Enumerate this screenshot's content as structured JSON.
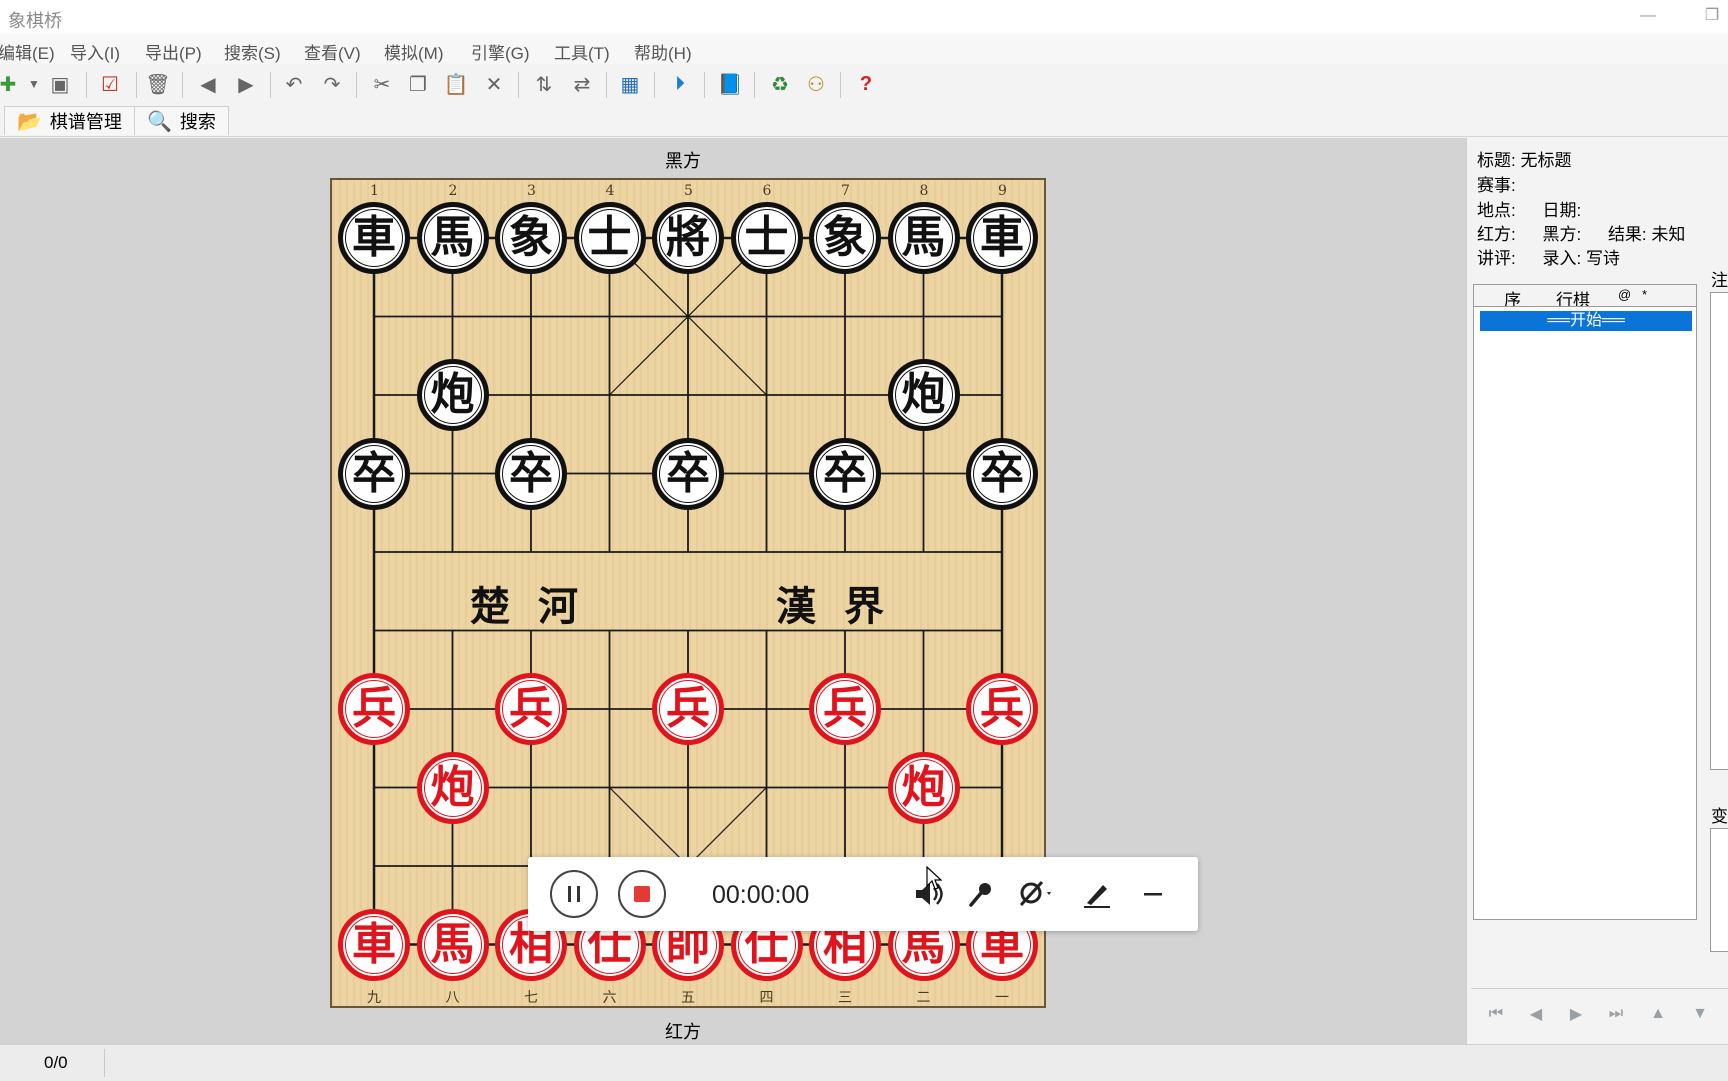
{
  "window": {
    "title": "象棋桥"
  },
  "menu": [
    "编辑(E)",
    "导入(I)",
    "导出(P)",
    "搜索(S)",
    "查看(V)",
    "模拟(M)",
    "引擎(G)",
    "工具(T)",
    "帮助(H)"
  ],
  "tabs": {
    "manage": "棋谱管理",
    "search": "搜索"
  },
  "board": {
    "black_side_label": "黑方",
    "red_side_label": "红方",
    "top_numbers": [
      "1",
      "2",
      "3",
      "4",
      "5",
      "6",
      "7",
      "8",
      "9"
    ],
    "bottom_numbers": [
      "九",
      "八",
      "七",
      "六",
      "五",
      "四",
      "三",
      "二",
      "一"
    ],
    "river_left": "楚河",
    "river_right": "漢界",
    "pieces": [
      {
        "c": "black",
        "t": "車",
        "x": 0,
        "y": 0
      },
      {
        "c": "black",
        "t": "馬",
        "x": 1,
        "y": 0
      },
      {
        "c": "black",
        "t": "象",
        "x": 2,
        "y": 0
      },
      {
        "c": "black",
        "t": "士",
        "x": 3,
        "y": 0
      },
      {
        "c": "black",
        "t": "將",
        "x": 4,
        "y": 0
      },
      {
        "c": "black",
        "t": "士",
        "x": 5,
        "y": 0
      },
      {
        "c": "black",
        "t": "象",
        "x": 6,
        "y": 0
      },
      {
        "c": "black",
        "t": "馬",
        "x": 7,
        "y": 0
      },
      {
        "c": "black",
        "t": "車",
        "x": 8,
        "y": 0
      },
      {
        "c": "black",
        "t": "炮",
        "x": 1,
        "y": 2
      },
      {
        "c": "black",
        "t": "炮",
        "x": 7,
        "y": 2
      },
      {
        "c": "black",
        "t": "卒",
        "x": 0,
        "y": 3
      },
      {
        "c": "black",
        "t": "卒",
        "x": 2,
        "y": 3
      },
      {
        "c": "black",
        "t": "卒",
        "x": 4,
        "y": 3
      },
      {
        "c": "black",
        "t": "卒",
        "x": 6,
        "y": 3
      },
      {
        "c": "black",
        "t": "卒",
        "x": 8,
        "y": 3
      },
      {
        "c": "red",
        "t": "兵",
        "x": 0,
        "y": 6
      },
      {
        "c": "red",
        "t": "兵",
        "x": 2,
        "y": 6
      },
      {
        "c": "red",
        "t": "兵",
        "x": 4,
        "y": 6
      },
      {
        "c": "red",
        "t": "兵",
        "x": 6,
        "y": 6
      },
      {
        "c": "red",
        "t": "兵",
        "x": 8,
        "y": 6
      },
      {
        "c": "red",
        "t": "炮",
        "x": 1,
        "y": 7
      },
      {
        "c": "red",
        "t": "炮",
        "x": 7,
        "y": 7
      },
      {
        "c": "red",
        "t": "車",
        "x": 0,
        "y": 9
      },
      {
        "c": "red",
        "t": "馬",
        "x": 1,
        "y": 9
      },
      {
        "c": "red",
        "t": "相",
        "x": 2,
        "y": 9
      },
      {
        "c": "red",
        "t": "仕",
        "x": 3,
        "y": 9
      },
      {
        "c": "red",
        "t": "帥",
        "x": 4,
        "y": 9
      },
      {
        "c": "red",
        "t": "仕",
        "x": 5,
        "y": 9
      },
      {
        "c": "red",
        "t": "相",
        "x": 6,
        "y": 9
      },
      {
        "c": "red",
        "t": "馬",
        "x": 7,
        "y": 9
      },
      {
        "c": "red",
        "t": "車",
        "x": 8,
        "y": 9
      }
    ]
  },
  "recorder": {
    "time": "00:00:00"
  },
  "info": {
    "title_label": "标题:",
    "title_value": "无标题",
    "event_label": "赛事:",
    "place_label": "地点:",
    "date_label": "日期:",
    "red_label": "红方:",
    "black_label": "黑方:",
    "result_label": "结果:",
    "result_value": "未知",
    "comment_label": "讲评:",
    "entry_label": "录入:",
    "entry_value": "写诗"
  },
  "moves": {
    "headers": [
      "序",
      "行棋",
      "@",
      "*"
    ],
    "start": "══开始══"
  },
  "side_labels": {
    "notes": "注",
    "variations": "变"
  },
  "status": {
    "counter": "0/0"
  },
  "colors": {
    "red": "#e0141c",
    "black": "#111111",
    "board": "#edd5a3",
    "selection": "#0a74d9"
  }
}
